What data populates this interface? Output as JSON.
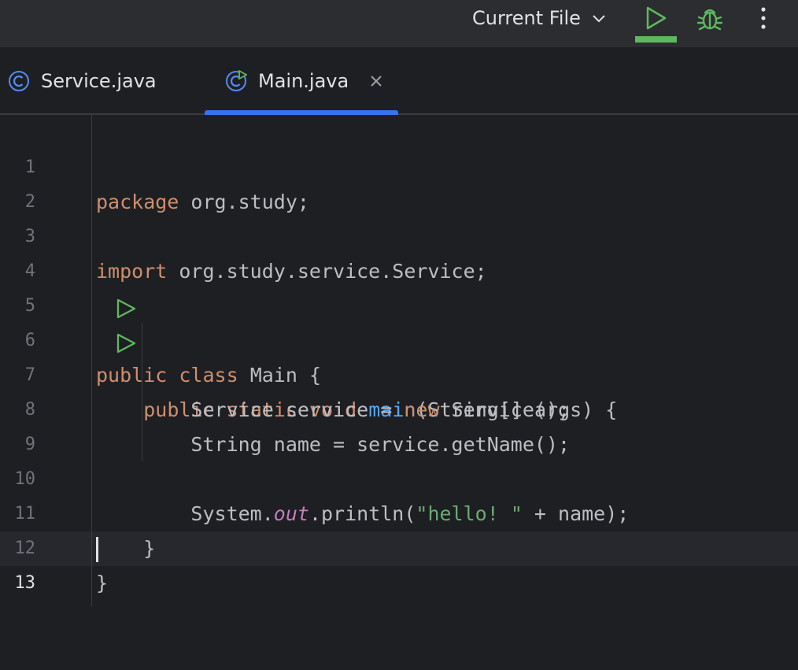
{
  "toolbar": {
    "run_config_label": "Current File",
    "icons": {
      "run": "run-icon",
      "debug": "debug-bug-icon",
      "more": "more-vertical-icon",
      "chevron": "chevron-down-icon"
    },
    "colors": {
      "run": "#5fb85f",
      "debug": "#5fb85f"
    }
  },
  "tabs": [
    {
      "label": "Service.java",
      "icon": "class-icon"
    },
    {
      "label": "Main.java",
      "icon": "class-runnable-icon",
      "active": true
    }
  ],
  "editor": {
    "line_numbers": [
      "1",
      "2",
      "3",
      "4",
      "5",
      "6",
      "7",
      "8",
      "9",
      "10",
      "11",
      "12",
      "13"
    ],
    "current_line": "13",
    "run_gutter_lines": [
      "5",
      "6"
    ],
    "code": {
      "l1": {
        "kw": "package",
        "rest": " org.study;"
      },
      "l3": {
        "kw": "import",
        "rest": " org.study.service.Service;"
      },
      "l5": {
        "kw1": "public",
        "kw2": "class",
        "rest": " Main {"
      },
      "l6": {
        "indent": "    ",
        "kw1": "public",
        "kw2": "static",
        "kw3": "void",
        "fn": "main",
        "rest": "(String[] args) {"
      },
      "l7": {
        "pre": "        Service service = ",
        "kw": "new",
        "rest": " Service();"
      },
      "l8": {
        "text": "        String name = service.getName();"
      },
      "l10": {
        "pre": "        System.",
        "field": "out",
        "mid": ".println(",
        "str": "\"hello! \"",
        "rest": " + name);"
      },
      "l11": {
        "text": "    }"
      },
      "l12": {
        "text": "}"
      }
    },
    "colors": {
      "keyword": "#cf8e6d",
      "function": "#56a8f5",
      "string": "#6aab73",
      "field": "#c77dbb",
      "text": "#bcbec4"
    }
  }
}
